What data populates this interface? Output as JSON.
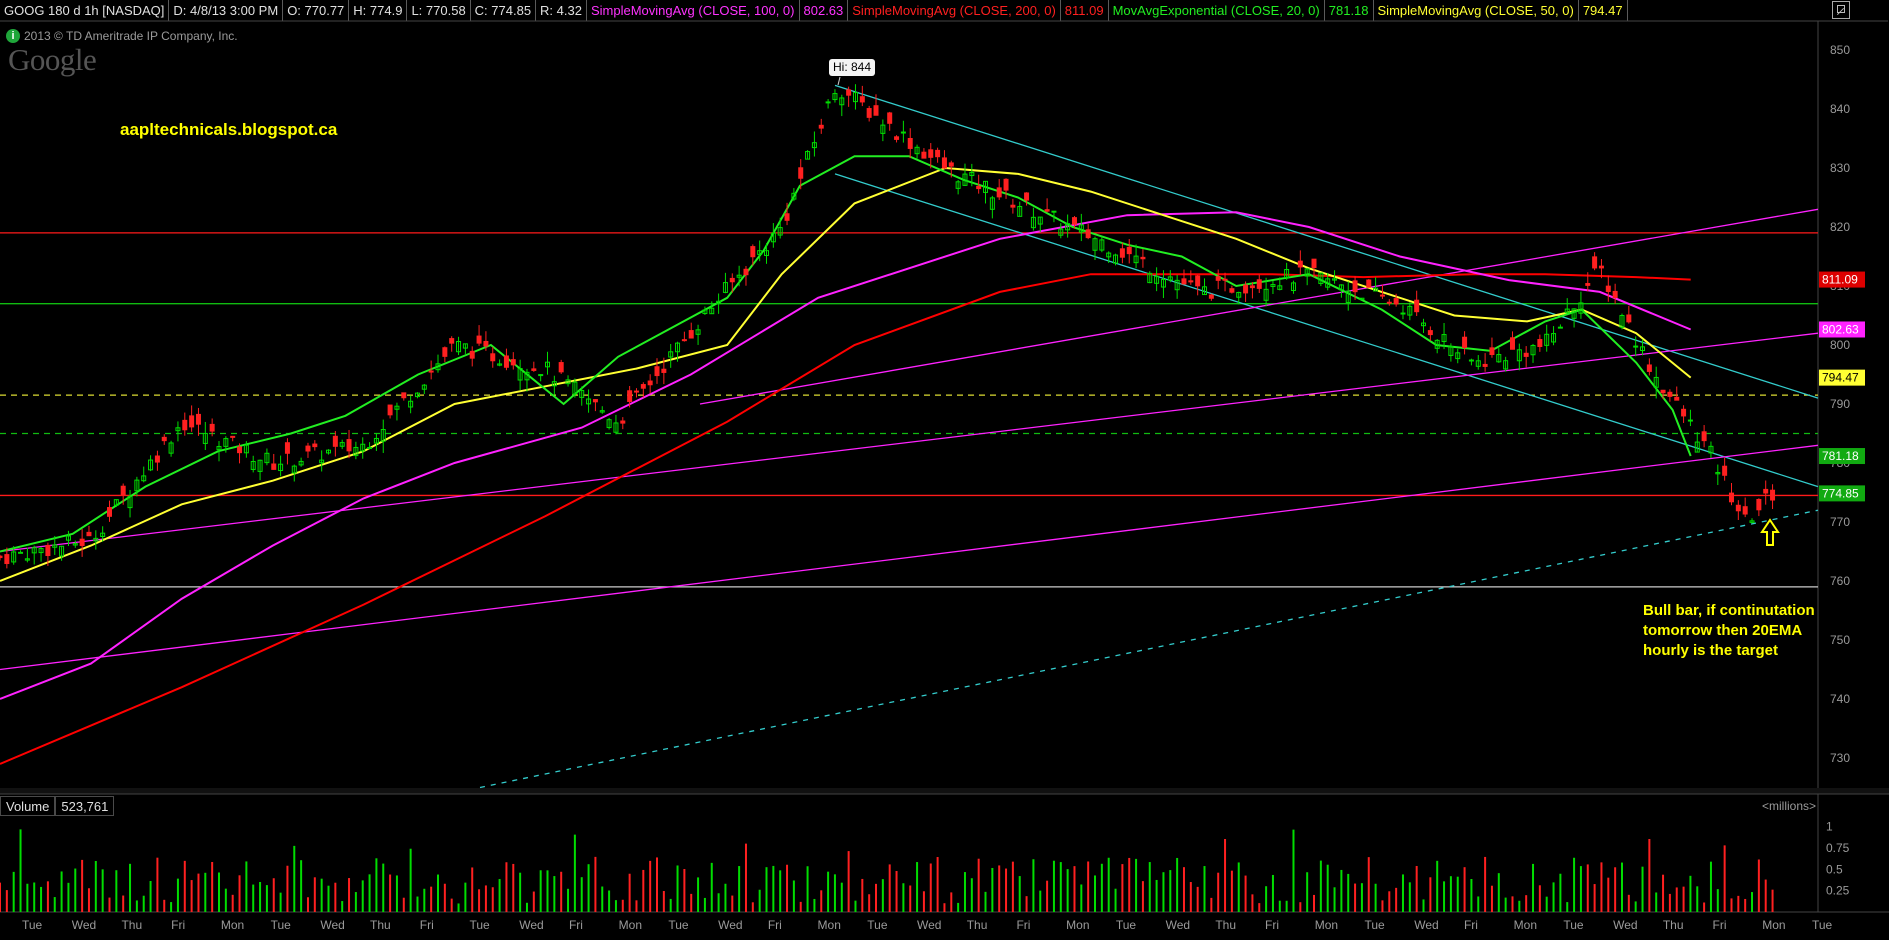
{
  "header": {
    "symbol": "GOOG 180 d 1h [NASDAQ]",
    "date": "D: 4/8/13 3:00 PM",
    "open": "O: 770.77",
    "high": "H: 774.9",
    "low": "L: 770.58",
    "close": "C: 774.85",
    "range": "R: 4.32",
    "sma100_label": "SimpleMovingAvg (CLOSE, 100, 0)",
    "sma100_value": "802.63",
    "sma200_label": "SimpleMovingAvg (CLOSE, 200, 0)",
    "sma200_value": "811.09",
    "ema20_label": "MovAvgExponential (CLOSE, 20, 0)",
    "ema20_value": "781.18",
    "sma50_label": "SimpleMovingAvg (CLOSE, 50, 0)",
    "sma50_value": "794.47"
  },
  "watermark": {
    "copyright": "2013 © TD Ameritrade IP Company, Inc.",
    "logo": "Google",
    "info_icon": "info-icon"
  },
  "annotations": {
    "site": "aapltechnicals.blogspot.ca",
    "high_marker": "Hi: 844",
    "note_line1": "Bull bar, if continutation",
    "note_line2": "tomorrow then 20EMA",
    "note_line3": "hourly is the target"
  },
  "volume_panel": {
    "label": "Volume",
    "value": "523,761",
    "units": "<millions>"
  },
  "colors": {
    "background": "#000000",
    "up_candle": "#00dd00",
    "down_candle": "#ff2020",
    "sma100": "#ff22ff",
    "sma200": "#ff0000",
    "ema20": "#22ee22",
    "sma50": "#ffff33",
    "trend_cyan": "#33cccc",
    "axis_text": "#9a9a9a",
    "price_label_close": "#22aa22"
  },
  "chart_data": {
    "type": "candlestick",
    "title": "GOOG 180 d 1h [NASDAQ]",
    "y_ticks": [
      850,
      840,
      830,
      820,
      810,
      800,
      790,
      780,
      770,
      760,
      750,
      740,
      730
    ],
    "ylim": [
      725,
      852
    ],
    "x_ticks": [
      "Tue",
      "Wed",
      "Thu",
      "Fri",
      "Mon",
      "Tue",
      "Wed",
      "Thu",
      "Fri",
      "Tue",
      "Wed",
      "Fri",
      "Mon",
      "Tue",
      "Wed",
      "Fri",
      "Mon",
      "Tue",
      "Wed",
      "Thu",
      "Fri",
      "Mon",
      "Tue",
      "Wed",
      "Thu",
      "Fri",
      "Mon",
      "Tue",
      "Wed",
      "Fri",
      "Mon",
      "Tue",
      "Wed",
      "Thu",
      "Fri",
      "Mon",
      "Tue"
    ],
    "price_labels": [
      {
        "series": "SMA 200",
        "value": 811.09,
        "text": "811.09"
      },
      {
        "series": "SMA 100",
        "value": 802.63,
        "text": "802.63"
      },
      {
        "series": "SMA 50",
        "value": 794.47,
        "text": "794.47"
      },
      {
        "series": "EMA 20",
        "value": 781.18,
        "text": "781.18"
      },
      {
        "series": "Close",
        "value": 774.85,
        "text": "774.85"
      }
    ],
    "high": 844,
    "horizontal_lines": [
      {
        "value": 819,
        "style": "solid",
        "color": "red"
      },
      {
        "value": 807,
        "style": "solid",
        "color": "green"
      },
      {
        "value": 791.5,
        "style": "dashed",
        "color": "yellow"
      },
      {
        "value": 785,
        "style": "dashed",
        "color": "green"
      },
      {
        "value": 774.5,
        "style": "solid",
        "color": "red"
      },
      {
        "value": 759,
        "style": "solid",
        "color": "white"
      }
    ],
    "key_closes": [
      {
        "x": 0,
        "close": 764
      },
      {
        "x": 0.05,
        "close": 767
      },
      {
        "x": 0.1,
        "close": 787
      },
      {
        "x": 0.15,
        "close": 780
      },
      {
        "x": 0.2,
        "close": 783
      },
      {
        "x": 0.25,
        "close": 800
      },
      {
        "x": 0.3,
        "close": 796
      },
      {
        "x": 0.34,
        "close": 787
      },
      {
        "x": 0.39,
        "close": 806
      },
      {
        "x": 0.43,
        "close": 820
      },
      {
        "x": 0.46,
        "close": 844
      },
      {
        "x": 0.52,
        "close": 830
      },
      {
        "x": 0.56,
        "close": 824
      },
      {
        "x": 0.61,
        "close": 817
      },
      {
        "x": 0.66,
        "close": 809
      },
      {
        "x": 0.72,
        "close": 812
      },
      {
        "x": 0.77,
        "close": 807
      },
      {
        "x": 0.81,
        "close": 797
      },
      {
        "x": 0.85,
        "close": 800
      },
      {
        "x": 0.88,
        "close": 813
      },
      {
        "x": 0.91,
        "close": 795
      },
      {
        "x": 0.94,
        "close": 782
      },
      {
        "x": 0.96,
        "close": 770
      },
      {
        "x": 0.975,
        "close": 774.85
      }
    ],
    "volume_ticks": [
      "1",
      "0.75",
      "0.5",
      "0.25"
    ],
    "volume_ylim": [
      0,
      1.1
    ],
    "volume_units": "<millions>",
    "volume_last": 0.523761,
    "grid": false
  }
}
